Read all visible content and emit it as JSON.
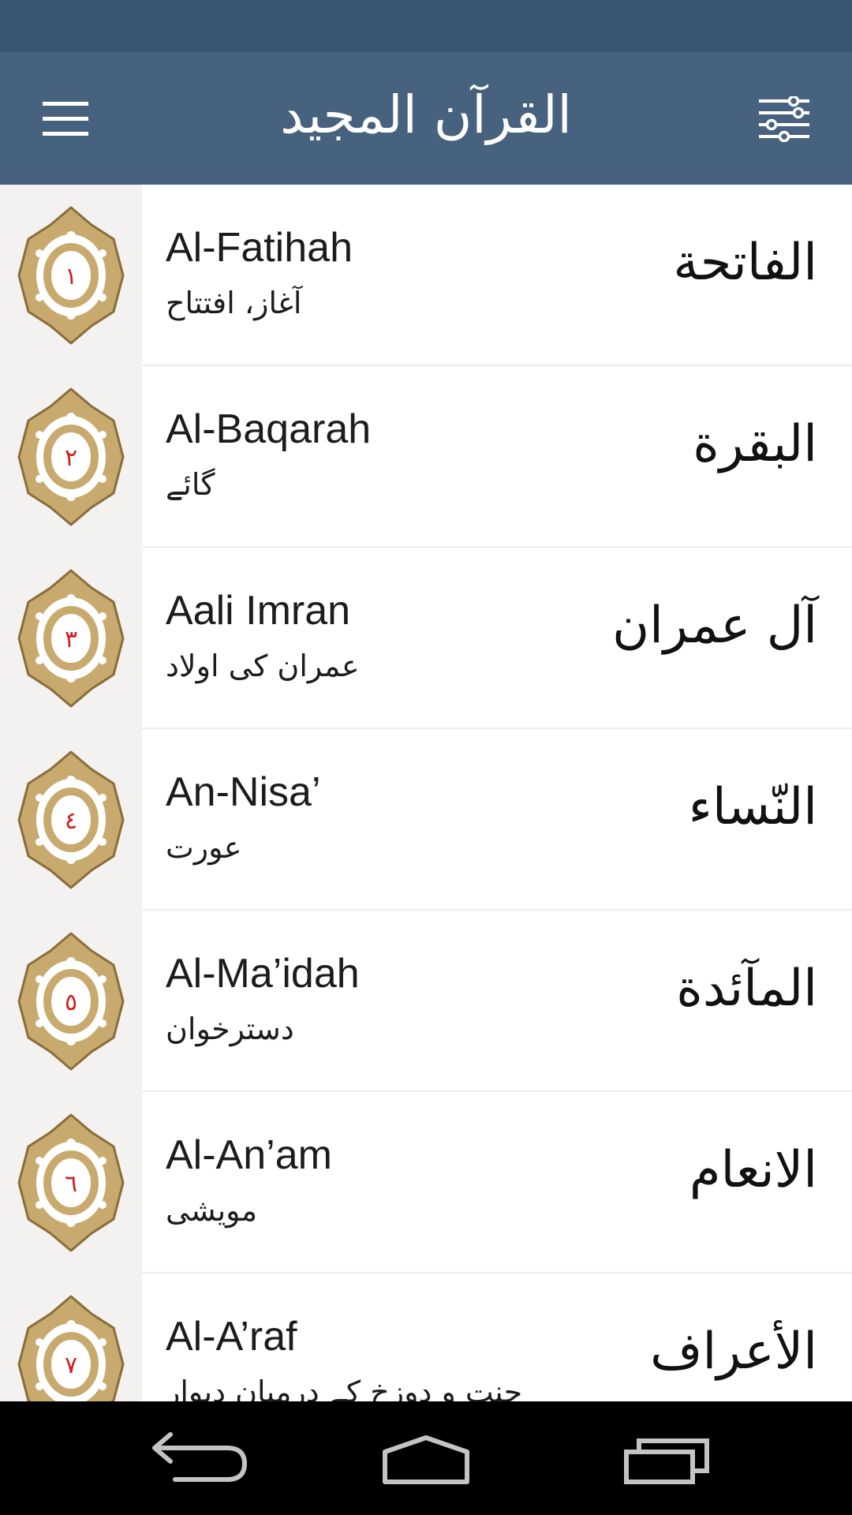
{
  "app_bar": {
    "title": "القرآن المجيد",
    "menu_icon": "hamburger-menu-icon",
    "filter_icon": "sliders-icon"
  },
  "surahs": [
    {
      "number": "١",
      "name_en": "Al-Fatihah",
      "name_ur": "آغاز، افتتاح",
      "name_ar": "الفاتحة"
    },
    {
      "number": "٢",
      "name_en": "Al-Baqarah",
      "name_ur": "گائے",
      "name_ar": "البقرة"
    },
    {
      "number": "٣",
      "name_en": "Aali Imran",
      "name_ur": "عمران کی اولاد",
      "name_ar": "آل عمران"
    },
    {
      "number": "٤",
      "name_en": "An-Nisa’",
      "name_ur": "عورت",
      "name_ar": "النّساء"
    },
    {
      "number": "٥",
      "name_en": "Al-Ma’idah",
      "name_ur": "دسترخوان",
      "name_ar": "المآئدة"
    },
    {
      "number": "٦",
      "name_en": "Al-An’am",
      "name_ur": "مویشی",
      "name_ar": "الانعام"
    },
    {
      "number": "٧",
      "name_en": "Al-A’raf",
      "name_ur": "جنت و دوزخ کے درمیان دیوار",
      "name_ar": "الأعراف"
    }
  ],
  "nav": {
    "back_icon": "back-arrow-icon",
    "home_icon": "home-icon",
    "recents_icon": "recent-apps-icon"
  },
  "colors": {
    "status_bar": "#3b5574",
    "app_bar": "#47627f",
    "badge_gold": "#c8aa6e",
    "badge_number": "#d01c1c",
    "badge_column": "#f3f2f0"
  }
}
